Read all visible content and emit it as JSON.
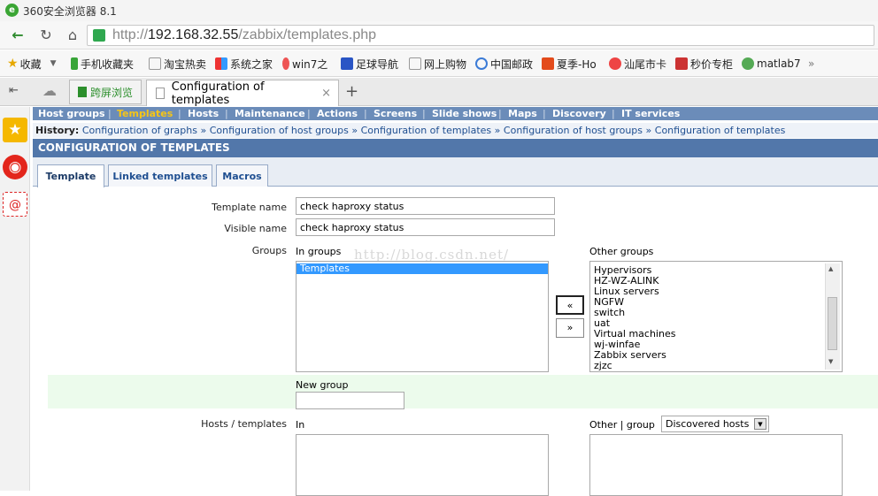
{
  "browser": {
    "title": "360安全浏览器 8.1",
    "url_prefix": "http://",
    "url_host": "192.168.32.55",
    "url_path": "/zabbix/templates.php",
    "favorites": [
      "收藏",
      "手机收藏夹",
      "淘宝热卖",
      "系统之家",
      "win7之",
      "足球导航",
      "网上购物",
      "中国邮政",
      "夏季-Ho",
      "汕尾市卡",
      "秒价专柜",
      "matlab7",
      "»"
    ],
    "tab_other": "跨屏浏览",
    "tab_active": "Configuration of templates",
    "tab_close": "×",
    "tab_new": "+"
  },
  "menu": [
    "Host groups",
    "Templates",
    "Hosts",
    "Maintenance",
    "Actions",
    "Screens",
    "Slide shows",
    "Maps",
    "Discovery",
    "IT services"
  ],
  "menu_active_color": "#f5c518",
  "history": {
    "label": "History:",
    "items": [
      "Configuration of graphs",
      "Configuration of host groups",
      "Configuration of templates",
      "Configuration of host groups",
      "Configuration of templates"
    ],
    "sep": "»"
  },
  "header": "CONFIGURATION OF TEMPLATES",
  "tabs": [
    "Template",
    "Linked templates",
    "Macros"
  ],
  "form": {
    "template_name_label": "Template name",
    "template_name_value": "check haproxy status",
    "visible_name_label": "Visible name",
    "visible_name_value": "check haproxy status",
    "groups_label": "Groups",
    "in_groups_label": "In groups",
    "in_groups": [
      "Templates"
    ],
    "other_groups_label": "Other groups",
    "other_groups": [
      "Hypervisors",
      "HZ-WZ-ALINK",
      "Linux servers",
      "NGFW",
      "switch",
      "uat",
      "Virtual machines",
      "wj-winfae",
      "Zabbix servers",
      "zjzc"
    ],
    "move_left": "«",
    "move_right": "»",
    "new_group_label": "New group",
    "hosts_templates_label": "Hosts / templates",
    "in_label": "In",
    "other_group_label": "Other | group",
    "group_select_value": "Discovered hosts"
  },
  "watermark": "http://blog.csdn.net/"
}
